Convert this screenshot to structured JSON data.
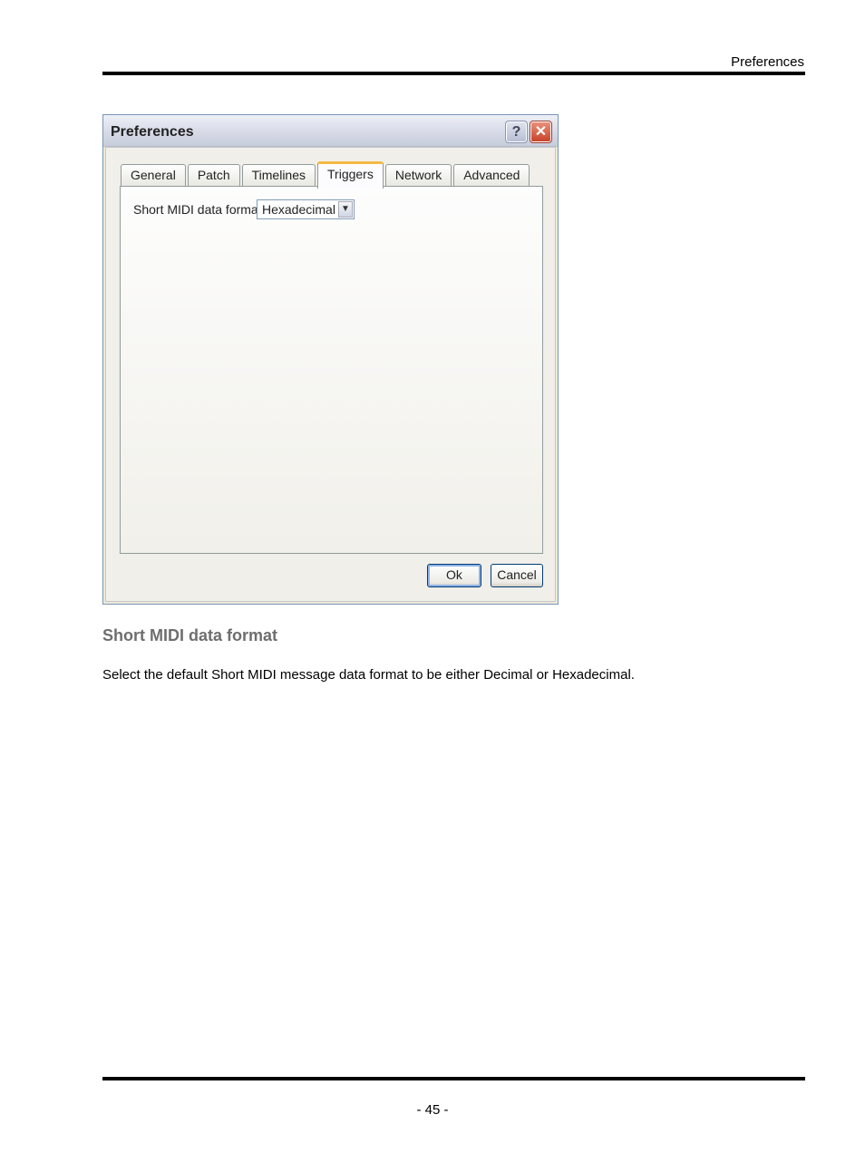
{
  "page": {
    "running_header": "Preferences",
    "page_number": "- 45 -"
  },
  "dialog": {
    "title": "Preferences",
    "help_glyph": "?",
    "close_glyph": "✕",
    "tabs": [
      {
        "label": "General",
        "active": false
      },
      {
        "label": "Patch",
        "active": false
      },
      {
        "label": "Timelines",
        "active": false
      },
      {
        "label": "Triggers",
        "active": true
      },
      {
        "label": "Network",
        "active": false
      },
      {
        "label": "Advanced",
        "active": false
      }
    ],
    "field_label": "Short MIDI data format",
    "select_value": "Hexadecimal",
    "select_arrow": "▼",
    "ok_label": "Ok",
    "cancel_label": "Cancel"
  },
  "section": {
    "heading": "Short MIDI data format",
    "body": "Select the default Short MIDI message data format to be either Decimal or Hexadecimal."
  }
}
